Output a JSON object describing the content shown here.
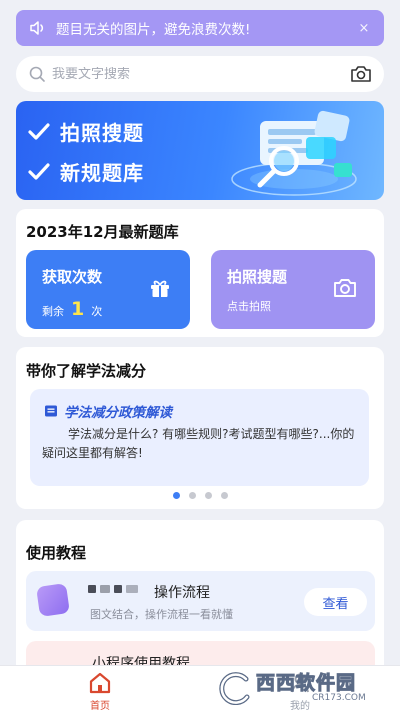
{
  "notice": {
    "icon": "speaker-icon",
    "text": "题目无关的图片，避免浪费次数!",
    "close": "×"
  },
  "search": {
    "placeholder": "我要文字搜索",
    "camera_icon": "camera-icon"
  },
  "banner": {
    "line1": "拍照搜题",
    "line2": "新规题库"
  },
  "quick": {
    "title": "2023年12月最新题库",
    "get_count": {
      "label": "获取次数",
      "remaining_prefix": "剩余",
      "remaining_value": "1",
      "remaining_suffix": "次",
      "icon": "gift-icon"
    },
    "photo_search": {
      "label": "拍照搜题",
      "sub": "点击拍照",
      "icon": "camera-icon"
    }
  },
  "learn": {
    "title": "带你了解学法减分",
    "policy_title": "学法减分政策解读",
    "policy_body": "学法减分是什么? 有哪些规则?考试题型有哪些?...你的疑问这里都有解答!",
    "dots": 4,
    "active_dot": 0
  },
  "tutorial": {
    "title": "使用教程",
    "item1": {
      "title": "操作流程",
      "sub": "图文结合，操作流程一看就懂",
      "button": "查看"
    },
    "item2": {
      "title": "小程序使用教程"
    }
  },
  "tabbar": {
    "home": "首页",
    "mine": "我的"
  },
  "watermark": {
    "text": "西西软件园",
    "sub": "CR173.COM"
  },
  "colors": {
    "notice_bg": "#a497f4",
    "primary_blue": "#3d7ef5",
    "purple": "#9f93f2",
    "accent_yellow": "#ffe54a",
    "home_active": "#d9482f"
  }
}
